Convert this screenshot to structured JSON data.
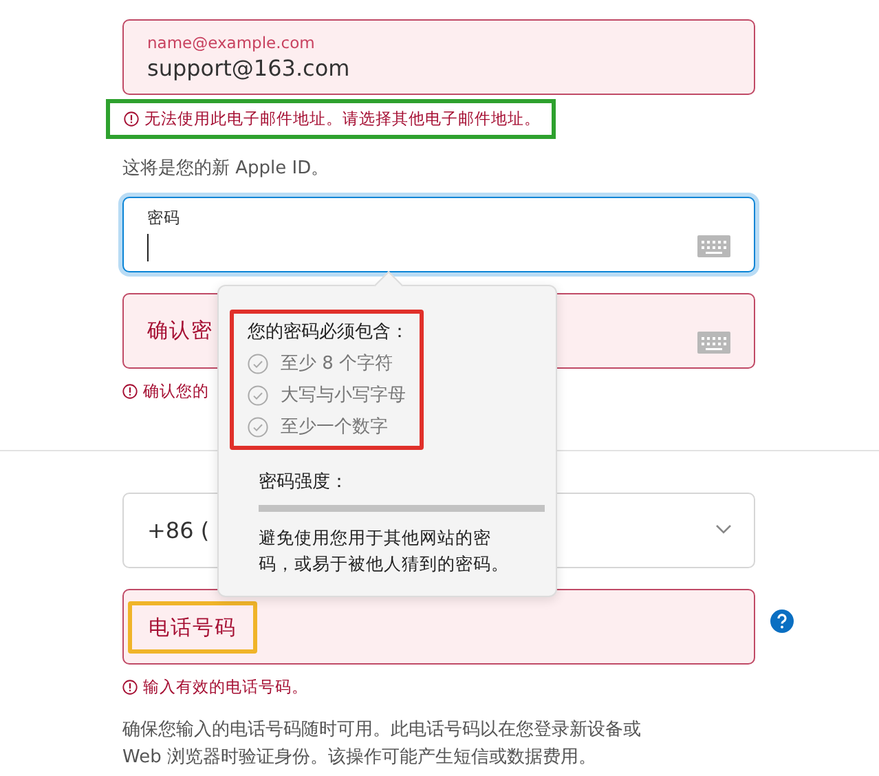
{
  "email_field": {
    "label": "name@example.com",
    "value": "support@163.com",
    "invalid": true
  },
  "email_error": {
    "text": "无法使用此电子邮件地址。请选择其他电子邮件地址。",
    "highlighted": true
  },
  "apple_id_note": "这将是您的新 Apple ID。",
  "password_field": {
    "label": "密码",
    "focused": true
  },
  "confirm_field": {
    "label": "确认密",
    "invalid": true
  },
  "confirm_error": "确认您的",
  "country_select": {
    "value": "+86 ("
  },
  "phone_field": {
    "label": "电话号码",
    "invalid": true,
    "highlighted": true
  },
  "phone_error": "输入有效的电话号码。",
  "phone_note": "确保您输入的电话号码随时可用。此电话号码以在您登录新设备或 Web 浏览器时验证身份。该操作可能产生短信或数据费用。",
  "popover": {
    "title": "您的密码必须包含：",
    "highlighted": true,
    "requirements": [
      {
        "text": "至少 8 个字符",
        "met": false
      },
      {
        "text": "大写与小写字母",
        "met": false
      },
      {
        "text": "至少一个数字",
        "met": false
      }
    ],
    "strength_label": "密码强度：",
    "strength": {
      "level": 0
    },
    "advice": "避免使用您用于其他网站的密码，或易于被他人猜到的密码。"
  }
}
